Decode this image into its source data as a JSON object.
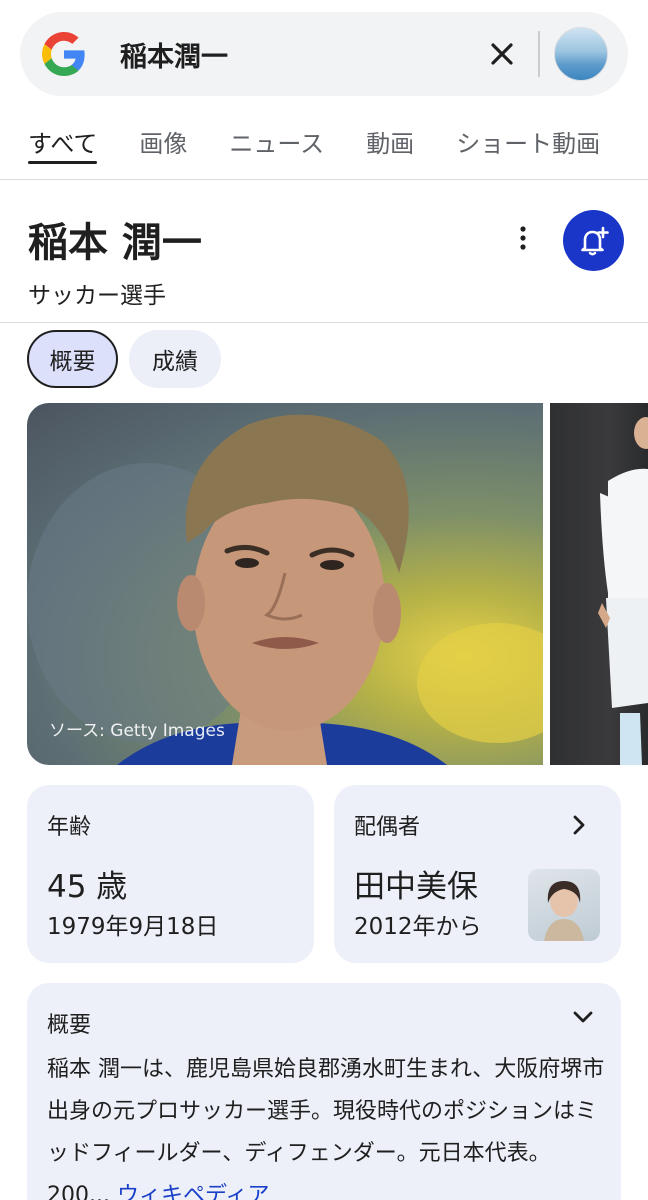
{
  "search": {
    "query": "稲本潤一"
  },
  "tabs": [
    "すべて",
    "画像",
    "ニュース",
    "動画",
    "ショート動画"
  ],
  "knowledge_panel": {
    "title": "稲本 潤一",
    "subtitle": "サッカー選手",
    "chips": [
      "概要",
      "成績"
    ],
    "image_caption": "ソース: Getty Images",
    "age_card": {
      "label": "年齢",
      "value": "45 歳",
      "sub": "1979年9月18日"
    },
    "spouse_card": {
      "label": "配偶者",
      "value": "田中美保",
      "sub": "2012年から"
    },
    "summary": {
      "label": "概要",
      "text": "稲本 潤一は、鹿児島県姶良郡湧水町生まれ、大阪府堺市出身の元プロサッカー選手。現役時代のポジションはミッドフィールダー、ディフェンダー。元日本代表。 200...",
      "link_text": "ウィキペディア"
    }
  },
  "colors": {
    "accent": "#1a36c8",
    "chip_selected": "#dce0fb",
    "card_bg": "#edf0f9",
    "link": "#1a3fc8"
  }
}
